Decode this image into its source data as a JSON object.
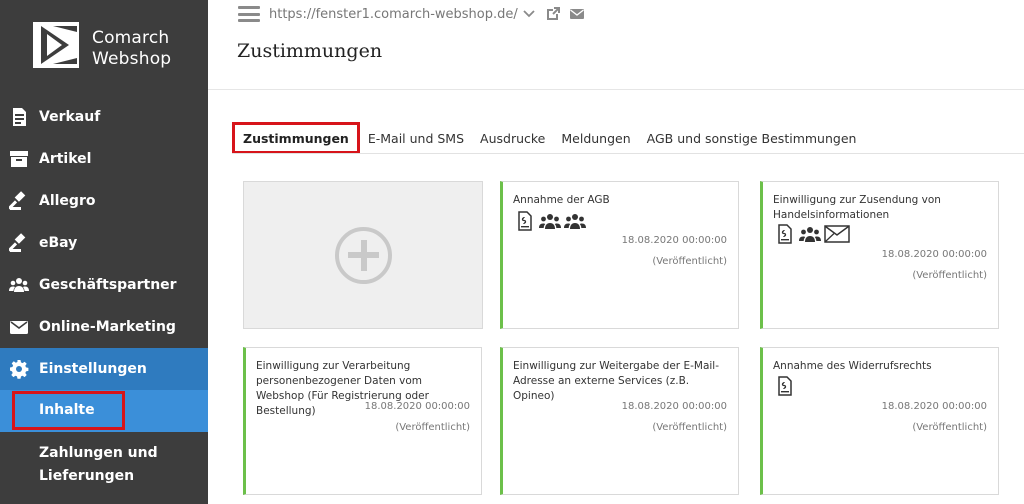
{
  "brand": {
    "line1": "Comarch",
    "line2": "Webshop"
  },
  "sidebar": {
    "items": [
      {
        "label": "Verkauf",
        "icon": "document-icon"
      },
      {
        "label": "Artikel",
        "icon": "box-icon"
      },
      {
        "label": "Allegro",
        "icon": "gavel-icon"
      },
      {
        "label": "eBay",
        "icon": "gavel-icon"
      },
      {
        "label": "Geschäftspartner",
        "icon": "users-icon"
      },
      {
        "label": "Online-Marketing",
        "icon": "envelope-icon"
      },
      {
        "label": "Einstellungen",
        "icon": "gear-icon"
      }
    ],
    "subitems": [
      {
        "label": "Inhalte"
      },
      {
        "label": "Zahlungen und Lieferungen"
      }
    ]
  },
  "header": {
    "url": "https://fenster1.comarch-webshop.de/",
    "title": "Zustimmungen"
  },
  "tabs": [
    "Zustimmungen",
    "E-Mail und SMS",
    "Ausdrucke",
    "Meldungen",
    "AGB und sonstige Bestimmungen"
  ],
  "cards": [
    {
      "title": "Annahme der AGB",
      "date": "18.08.2020 00:00:00",
      "status": "(Veröffentlicht)",
      "icons": [
        "document-icon",
        "users-icon",
        "users-icon"
      ]
    },
    {
      "title": "Einwilligung zur Zusendung von Handelsinformationen",
      "date": "18.08.2020 00:00:00",
      "status": "(Veröffentlicht)",
      "icons": [
        "document-icon",
        "users-icon",
        "envelope-icon"
      ]
    },
    {
      "title": "Einwilligung zur Verarbeitung personenbezogener Daten vom Webshop (Für Registrierung oder Bestellung)",
      "date": "18.08.2020 00:00:00",
      "status": "(Veröffentlicht)",
      "icons": []
    },
    {
      "title": "Einwilligung zur Weitergabe der E-Mail-Adresse an externe Services (z.B. Opineo)",
      "date": "18.08.2020 00:00:00",
      "status": "(Veröffentlicht)",
      "icons": []
    },
    {
      "title": "Annahme des Widerrufsrechts",
      "date": "18.08.2020 00:00:00",
      "status": "(Veröffentlicht)",
      "icons": [
        "document-icon"
      ]
    }
  ],
  "colors": {
    "sidebar": "#3d3d3d",
    "active": "#2f7bbf",
    "sub_active": "#3b8fd9",
    "accent_green": "#6cc04a",
    "highlight_red": "#d7141a"
  }
}
